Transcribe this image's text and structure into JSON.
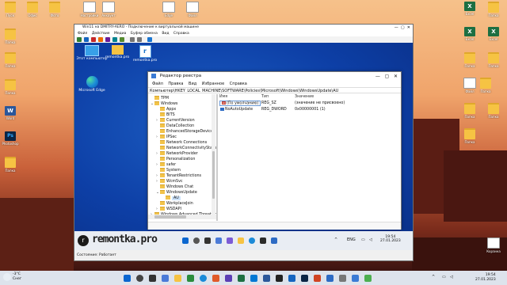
{
  "host": {
    "desktop_icons": [
      {
        "label": "Пуск",
        "kind": "folder"
      },
      {
        "label": "Офис",
        "kind": "folder"
      },
      {
        "label": "Фото",
        "kind": "folder"
      },
      {
        "label": "Настройки",
        "kind": "paper"
      },
      {
        "label": "Аккаунт",
        "kind": "paper"
      },
      {
        "label": "Edge",
        "kind": "paper"
      },
      {
        "label": "Файл",
        "kind": "paper"
      },
      {
        "label": "Папка",
        "kind": "folder"
      },
      {
        "label": "Папка",
        "kind": "folder"
      },
      {
        "label": "Папка",
        "kind": "folder"
      },
      {
        "label": "Папка",
        "kind": "folder"
      },
      {
        "label": "Word",
        "kind": "wd"
      },
      {
        "label": "Photoshop",
        "kind": "ps"
      },
      {
        "label": "Папка",
        "kind": "folder"
      },
      {
        "label": "Excel",
        "kind": "xl"
      },
      {
        "label": "Папка",
        "kind": "folder"
      },
      {
        "label": "Excel",
        "kind": "xl"
      },
      {
        "label": "Excel",
        "kind": "xl"
      },
      {
        "label": "Папка",
        "kind": "folder"
      },
      {
        "label": "Папка",
        "kind": "folder"
      },
      {
        "label": "Файл",
        "kind": "paper"
      },
      {
        "label": "Папка",
        "kind": "folder"
      },
      {
        "label": "Папка",
        "kind": "folder"
      },
      {
        "label": "Папка",
        "kind": "folder"
      },
      {
        "label": "Корзина",
        "kind": "bin"
      }
    ],
    "taskbar": {
      "weather": "-3°C",
      "weather_sub": "Снег",
      "time": "19:54",
      "date": "27.01.2023"
    }
  },
  "vm": {
    "title": "Win11 на DMITRY-AERO - Подключение к виртуальной машине",
    "menu": [
      "Файл",
      "Действие",
      "Медиа",
      "Буфер обмена",
      "Вид",
      "Справка"
    ],
    "status": "Состояние: Работает",
    "guest_icons": [
      {
        "label": "Этот компьютер"
      },
      {
        "label": "remontka.pro"
      },
      {
        "label": "remontka.pro"
      },
      {
        "label": "Microsoft Edge"
      }
    ],
    "guest_taskbar": {
      "brand": "remontka.pro",
      "lang": "ENG",
      "time": "19:54",
      "date": "27.01.2023"
    }
  },
  "regedit": {
    "title": "Редактор реестра",
    "menu": [
      "Файл",
      "Правка",
      "Вид",
      "Избранное",
      "Справка"
    ],
    "address": "Компьютер\\HKEY_LOCAL_MACHINE\\SOFTWARE\\Policies\\Microsoft\\Windows\\WindowsUpdate\\AU",
    "tree": [
      {
        "label": "TPM",
        "level": 0,
        "expander": ""
      },
      {
        "label": "Windows",
        "level": 0,
        "expander": "⌄"
      },
      {
        "label": "Appx",
        "level": 1,
        "expander": ""
      },
      {
        "label": "BITS",
        "level": 1,
        "expander": ""
      },
      {
        "label": "CurrentVersion",
        "level": 1,
        "expander": "›"
      },
      {
        "label": "DataCollection",
        "level": 1,
        "expander": ""
      },
      {
        "label": "EnhancedStorageDevices",
        "level": 1,
        "expander": ""
      },
      {
        "label": "IPSec",
        "level": 1,
        "expander": "›"
      },
      {
        "label": "Network Connections",
        "level": 1,
        "expander": ""
      },
      {
        "label": "NetworkConnectivityStatusI",
        "level": 1,
        "expander": ""
      },
      {
        "label": "NetworkProvider",
        "level": 1,
        "expander": "›"
      },
      {
        "label": "Personalization",
        "level": 1,
        "expander": ""
      },
      {
        "label": "safer",
        "level": 1,
        "expander": "›"
      },
      {
        "label": "System",
        "level": 1,
        "expander": ""
      },
      {
        "label": "TenantRestrictions",
        "level": 1,
        "expander": "›"
      },
      {
        "label": "WcmSvc",
        "level": 1,
        "expander": "›"
      },
      {
        "label": "Windows Chat",
        "level": 1,
        "expander": ""
      },
      {
        "label": "WindowsUpdate",
        "level": 1,
        "expander": "⌄"
      },
      {
        "label": "AU",
        "level": 2,
        "expander": "",
        "selected": true
      },
      {
        "label": "WorkplaceJoin",
        "level": 1,
        "expander": ""
      },
      {
        "label": "WSDAPI",
        "level": 1,
        "expander": "›"
      },
      {
        "label": "Windows Advanced Threat Pro",
        "level": 0,
        "expander": "›"
      }
    ],
    "columns": [
      "Имя",
      "Тип",
      "Значение"
    ],
    "values": [
      {
        "name": "(По умолчанию)",
        "type": "REG_SZ",
        "data": "(значение не присвоено)",
        "icon": "ab"
      },
      {
        "name": "NoAutoUpdate",
        "type": "REG_DWORD",
        "data": "0x00000001 (1)",
        "icon": "bin"
      }
    ]
  }
}
